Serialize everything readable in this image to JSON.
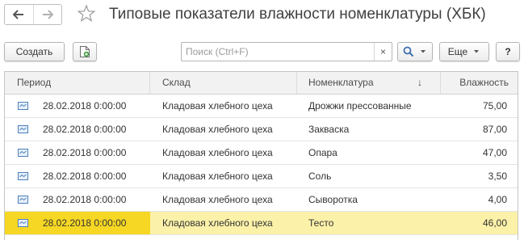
{
  "header": {
    "title": "Типовые показатели влажности номенклатуры (ХБК)",
    "back_icon": "arrow-left-icon",
    "forward_icon": "arrow-right-icon",
    "favorite_icon": "star-icon"
  },
  "toolbar": {
    "create_label": "Создать",
    "copy_icon": "copy-document-icon",
    "search_placeholder": "Поиск (Ctrl+F)",
    "clear_symbol": "×",
    "more_label": "Еще",
    "help_label": "?"
  },
  "table": {
    "columns": [
      "Период",
      "Склад",
      "Номенклатура",
      "Влажность"
    ],
    "sort_indicator": "↓",
    "rows": [
      {
        "period": "28.02.2018 0:00:00",
        "sklad": "Кладовая хлебного цеха",
        "nom": "Дрожжи прессованные",
        "value": "75,00"
      },
      {
        "period": "28.02.2018 0:00:00",
        "sklad": "Кладовая хлебного цеха",
        "nom": "Закваска",
        "value": "87,00"
      },
      {
        "period": "28.02.2018 0:00:00",
        "sklad": "Кладовая хлебного цеха",
        "nom": "Опара",
        "value": "47,00"
      },
      {
        "period": "28.02.2018 0:00:00",
        "sklad": "Кладовая хлебного цеха",
        "nom": "Соль",
        "value": "3,50"
      },
      {
        "period": "28.02.2018 0:00:00",
        "sklad": "Кладовая хлебного цеха",
        "nom": "Сыворотка",
        "value": "4,00"
      },
      {
        "period": "28.02.2018 0:00:00",
        "sklad": "Кладовая хлебного цеха",
        "nom": "Тесто",
        "value": "46,00"
      }
    ],
    "selected_index": 5
  },
  "colors": {
    "selected_row": "#fbf1a8",
    "selected_cell": "#f6d723",
    "header_bg": "#f2f2f2"
  }
}
